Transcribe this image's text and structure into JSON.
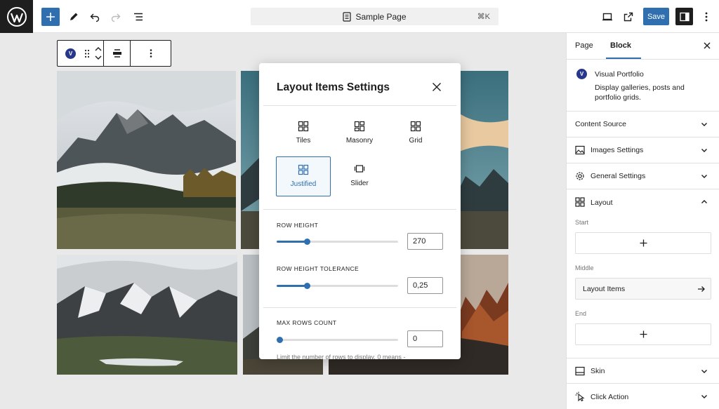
{
  "topbar": {
    "document_title": "Sample Page",
    "shortcut": "⌘K",
    "save_label": "Save",
    "icons": [
      "wordpress-logo",
      "plus-icon",
      "pen-icon",
      "undo-icon",
      "redo-icon",
      "list-view-icon",
      "desktop-icon",
      "external-link-icon",
      "sidebar-toggle-icon",
      "more-vertical-icon"
    ]
  },
  "block_toolbar": {
    "block_badge": "V"
  },
  "modal": {
    "title": "Layout Items Settings",
    "layout_options": [
      {
        "label": "Tiles",
        "icon": "tiles-icon",
        "active": false
      },
      {
        "label": "Masonry",
        "icon": "masonry-icon",
        "active": false
      },
      {
        "label": "Grid",
        "icon": "grid-icon",
        "active": false
      },
      {
        "label": "Justified",
        "icon": "justified-icon",
        "active": true
      },
      {
        "label": "Slider",
        "icon": "slider-icon",
        "active": false
      }
    ],
    "fields": [
      {
        "label": "ROW HEIGHT",
        "value": "270",
        "slider_fraction": 0.25
      },
      {
        "label": "ROW HEIGHT TOLERANCE",
        "value": "0,25",
        "slider_fraction": 0.25
      },
      {
        "label": "MAX ROWS COUNT",
        "value": "0",
        "slider_fraction": 0.0
      }
    ],
    "help_text": "Limit the number of rows to display. 0 means -"
  },
  "sidebar": {
    "tabs": [
      {
        "label": "Page",
        "active": false
      },
      {
        "label": "Block",
        "active": true
      }
    ],
    "block": {
      "badge": "V",
      "title": "Visual Portfolio",
      "description": "Display galleries, posts and portfolio grids."
    },
    "sections": {
      "content_source": "Content Source",
      "images_settings": "Images Settings",
      "general_settings": "General Settings",
      "layout": "Layout",
      "skin": "Skin",
      "click_action": "Click Action"
    },
    "layout_panel": {
      "start_label": "Start",
      "middle_label": "Middle",
      "end_label": "End",
      "layout_items": "Layout Items"
    }
  },
  "colors": {
    "accent": "#2f6fb0",
    "dark": "#1e1e1e",
    "badge": "#26378c"
  }
}
